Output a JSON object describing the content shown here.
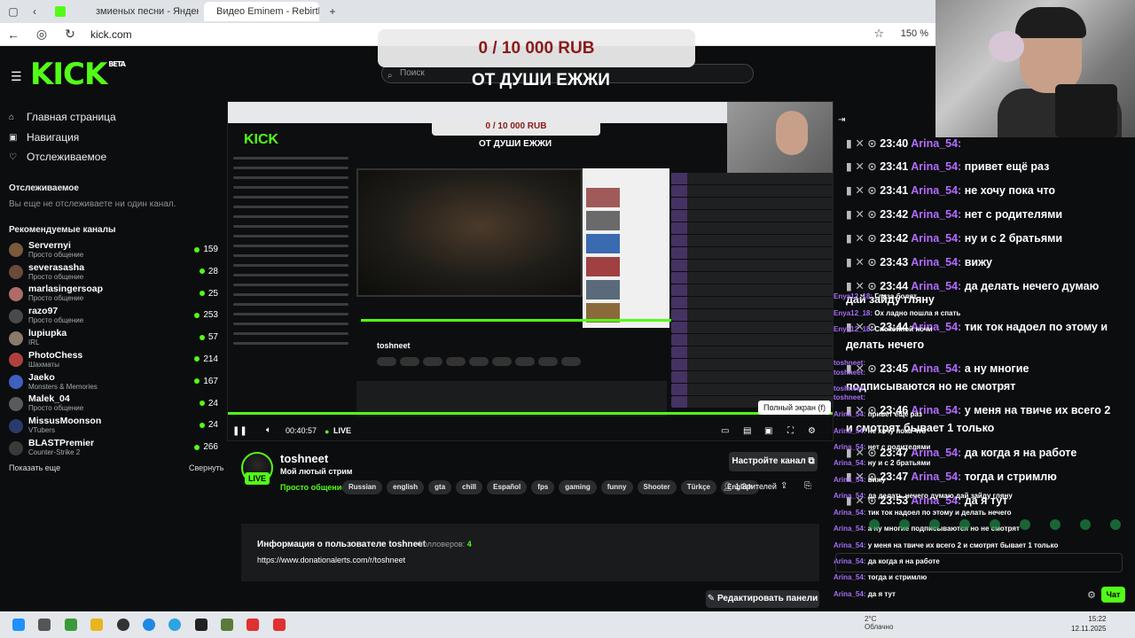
{
  "browser": {
    "tabs": [
      {
        "label": "",
        "favicon": "kick-icon"
      },
      {
        "label": "змиеных песни - Яндекс:",
        "favicon": "yandex-icon"
      },
      {
        "label": "Видео Eminem - Rebirth (I",
        "favicon": "video-icon"
      }
    ],
    "url": "kick.com",
    "zoom": "150 %"
  },
  "kick": {
    "logo": "KICK",
    "logo_sup": "BETA",
    "nav": [
      {
        "label": "Главная страница",
        "icon": "home-icon"
      },
      {
        "label": "Навигация",
        "icon": "compass-icon"
      },
      {
        "label": "Отслеживаемое",
        "icon": "heart-icon"
      }
    ],
    "following_title": "Отслеживаемое",
    "following_empty": "Вы еще не отслеживаете ни один канал.",
    "recommended_title": "Рекомендуемые каналы",
    "channels": [
      {
        "name": "Servernyi",
        "category": "Просто общение",
        "viewers": "159",
        "color": "#7a5a3a"
      },
      {
        "name": "severasasha",
        "category": "Просто общение",
        "viewers": "28",
        "color": "#6a4a3a"
      },
      {
        "name": "marlasingersoap",
        "category": "Просто общение",
        "viewers": "25",
        "color": "#b06a6a"
      },
      {
        "name": "razo97",
        "category": "Просто общение",
        "viewers": "253",
        "color": "#4a4a4a"
      },
      {
        "name": "lupiupka",
        "category": "IRL",
        "viewers": "57",
        "color": "#8a7a6a"
      },
      {
        "name": "PhotoChess",
        "category": "Шахматы",
        "viewers": "214",
        "color": "#b04040"
      },
      {
        "name": "Jaeko",
        "category": "Monsters & Memories",
        "viewers": "167",
        "color": "#4060c0"
      },
      {
        "name": "Malek_04",
        "category": "Просто общение",
        "viewers": "24",
        "color": "#5a5a5a"
      },
      {
        "name": "MissusMoonson",
        "category": "VTubers",
        "viewers": "24",
        "color": "#2a3a6a"
      },
      {
        "name": "BLASTPremier",
        "category": "Counter-Strike 2",
        "viewers": "266",
        "color": "#3a3a3a"
      }
    ],
    "show_more": "Показать еще",
    "collapse": "Свернуть",
    "search_placeholder": "Поиск"
  },
  "overlay": {
    "donation_amount": "0 / 10 000 RUB",
    "donation_title": "ОТ ДУШИ ЕЖЖИ",
    "fullscreen_tooltip": "Полный экран (f)"
  },
  "player": {
    "timecode": "00:40:57",
    "live": "LIVE"
  },
  "stream": {
    "streamer": "toshneet",
    "live_badge": "LIVE",
    "title": "Мой лютый стрим",
    "category": "Просто общение",
    "tags": [
      "Russian",
      "english",
      "gta",
      "chill",
      "Español",
      "fps",
      "gaming",
      "funny",
      "Shooter",
      "Türkçe",
      "English"
    ],
    "setup_button": "Настройте канал",
    "viewers": "1 Зрителей",
    "info_title": "Информация о пользователе toshneet",
    "followers_label": "Фолловеров:",
    "followers_count": "4",
    "info_link": "https://www.donationalerts.com/r/toshneet",
    "edit_panels": "Редактировать панели"
  },
  "chat": {
    "big_messages": [
      {
        "time": "23:40",
        "user": "Arina_54:",
        "text": ""
      },
      {
        "time": "23:41",
        "user": "Arina_54:",
        "text": "привет ещё раз"
      },
      {
        "time": "23:41",
        "user": "Arina_54:",
        "text": "не хочу пока что"
      },
      {
        "time": "23:42",
        "user": "Arina_54:",
        "text": "нет с родителями"
      },
      {
        "time": "23:42",
        "user": "Arina_54:",
        "text": "ну и с 2 братьями"
      },
      {
        "time": "23:43",
        "user": "Arina_54:",
        "text": "вижу"
      },
      {
        "time": "23:44",
        "user": "Arina_54:",
        "text": "да делать нечего думаю"
      },
      {
        "time": "",
        "user": "",
        "text": "дай зайду гляну"
      },
      {
        "time": "23:44",
        "user": "Arina_54:",
        "text": "тик ток надоел по этому и"
      },
      {
        "time": "",
        "user": "",
        "text": "делать нечего"
      },
      {
        "time": "23:45",
        "user": "Arina_54:",
        "text": "а ну многие"
      },
      {
        "time": "",
        "user": "",
        "text": "подписываются но не смотрят"
      },
      {
        "time": "23:46",
        "user": "Arina_54:",
        "text": "у меня на твиче их всего 2"
      },
      {
        "time": "",
        "user": "",
        "text": "и смотрят бывает 1 только"
      },
      {
        "time": "23:47",
        "user": "Arina_54:",
        "text": "да когда я на работе"
      },
      {
        "time": "23:47",
        "user": "Arina_54:",
        "text": "тогда и стримлю"
      },
      {
        "time": "23:53",
        "user": "Arina_54:",
        "text": "да я тут"
      }
    ],
    "small_messages": [
      {
        "user": "Enya12_18:",
        "text": "Глаза болят"
      },
      {
        "user": "Enya12_18:",
        "text": "Ох ладно пошла я спать"
      },
      {
        "user": "Enya12_18:",
        "text": "Спокойной ночи"
      },
      {
        "user": "toshneet:",
        "text": ""
      },
      {
        "user": "toshneet:",
        "text": ""
      },
      {
        "user": "toshneet:",
        "text": ""
      },
      {
        "user": "toshneet:",
        "text": ""
      },
      {
        "user": "Arina_54:",
        "text": "привет ещё раз"
      },
      {
        "user": "Arina_54:",
        "text": "не хочу пока что"
      },
      {
        "user": "Arina_54:",
        "text": "нет с родителями"
      },
      {
        "user": "Arina_54:",
        "text": "ну и с 2 братьями"
      },
      {
        "user": "Arina_54:",
        "text": "вижу"
      },
      {
        "user": "Arina_54:",
        "text": "да делать нечего думаю дай зайду гляну"
      },
      {
        "user": "Arina_54:",
        "text": "тик ток надоел по этому и делать нечего"
      },
      {
        "user": "Arina_54:",
        "text": "а ну многие подписываются но не смотрят"
      },
      {
        "user": "Arina_54:",
        "text": "у меня на твиче их всего 2 и смотрят бывает 1 только"
      },
      {
        "user": "Arina_54:",
        "text": "да когда я на работе"
      },
      {
        "user": "Arina_54:",
        "text": "тогда и стримлю"
      },
      {
        "user": "Arina_54:",
        "text": "да я тут"
      }
    ],
    "send_button": "Чат"
  },
  "taskbar": {
    "weather_temp": "2°C",
    "weather_desc": "Облачно",
    "time": "15:22",
    "date": "12.11.2025"
  }
}
